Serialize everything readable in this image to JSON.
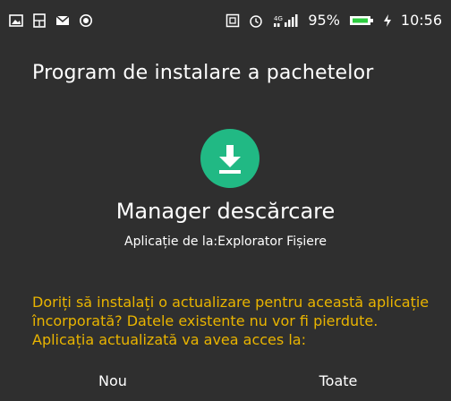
{
  "status_bar": {
    "battery_percent": "95%",
    "time": "10:56",
    "network_label": "4G",
    "left_icons": [
      "image-icon",
      "usb-icon",
      "mail-icon",
      "record-icon"
    ],
    "right_icons": [
      "nfc-icon",
      "alarm-icon",
      "signal-icon",
      "battery-icon",
      "charging-icon"
    ]
  },
  "header": {
    "title": "Program de instalare a pachetelor"
  },
  "app": {
    "icon": "download-icon",
    "icon_color": "#21b984",
    "name": "Manager descărcare",
    "source": "Aplicație de la:Explorator Fișiere"
  },
  "message": {
    "text": "Doriți să instalați o actualizare pentru această aplicație încorporată? Datele existente nu vor fi pierdute. Aplicația actualizată va avea acces la:",
    "color": "#e9b400"
  },
  "tabs": [
    {
      "label": "Nou"
    },
    {
      "label": "Toate"
    }
  ]
}
